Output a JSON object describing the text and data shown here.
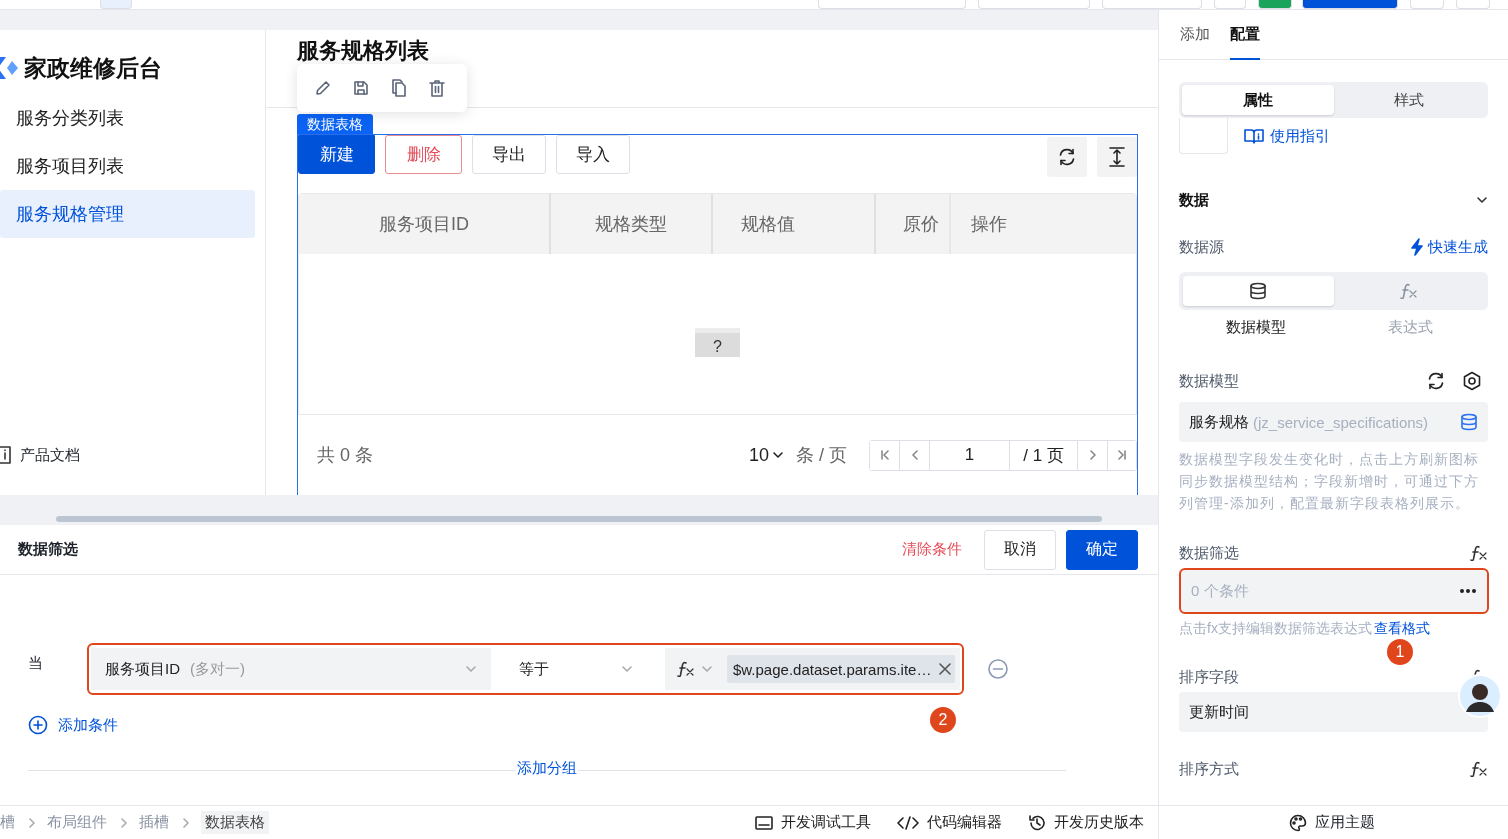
{
  "sidebar": {
    "app_title": "家政维修后台",
    "items": [
      {
        "label": "服务分类列表",
        "selected": false
      },
      {
        "label": "服务项目列表",
        "selected": false
      },
      {
        "label": "服务规格管理",
        "selected": true
      }
    ],
    "footer_link": "产品文档"
  },
  "canvas": {
    "page_title": "服务规格列表",
    "component_tag": "数据表格",
    "buttons": [
      {
        "label": "新建",
        "kind": "primary"
      },
      {
        "label": "删除",
        "kind": "danger"
      },
      {
        "label": "导出",
        "kind": "default"
      },
      {
        "label": "导入",
        "kind": "default"
      }
    ],
    "table": {
      "columns": [
        "服务项目ID",
        "规格类型",
        "规格值",
        "原价",
        "操作"
      ]
    },
    "help_tab": "?",
    "pagination": {
      "total_prefix": "共",
      "total": "0",
      "total_suffix": "条",
      "page_size": "10",
      "page_size_unit": "条 / 页",
      "page": "1",
      "page_total": "/ 1 页"
    }
  },
  "filter_dialog": {
    "title": "数据筛选",
    "clear": "清除条件",
    "cancel": "取消",
    "confirm": "确定",
    "when": "当",
    "condition": {
      "field": "服务项目ID",
      "field_note": "(多对一)",
      "operator": "等于",
      "value": "$w.page.dataset.params.ite…"
    },
    "badge": "2",
    "add_condition": "添加条件",
    "add_group": "添加分组"
  },
  "breadcrumb": [
    "槽",
    "布局组件",
    "插槽",
    "数据表格"
  ],
  "dev_tools": [
    "开发调试工具",
    "代码编辑器",
    "开发历史版本"
  ],
  "theme_button": "应用主题",
  "config_panel": {
    "tabs": [
      {
        "label": "添加",
        "selected": false
      },
      {
        "label": "配置",
        "selected": true
      }
    ],
    "mode_tabs": [
      {
        "label": "属性",
        "selected": true
      },
      {
        "label": "样式",
        "selected": false
      }
    ],
    "guide_link": "使用指引",
    "section": {
      "title": "数据",
      "expanded": true
    },
    "data_source": {
      "label": "数据源",
      "quick_link": "快速生成",
      "options": [
        {
          "kind": "model",
          "label": "数据模型",
          "selected": true
        },
        {
          "kind": "expression",
          "label": "表达式",
          "selected": false
        }
      ]
    },
    "data_model": {
      "label": "数据模型",
      "name": "服务规格",
      "table": "(jz_service_specifications)",
      "hint": "数据模型字段发生变化时，点击上方刷新图标同步数据模型结构；字段新增时，可通过下方列管理-添加列，配置最新字段表格列展示。"
    },
    "filter": {
      "label": "数据筛选",
      "value": "0 个条件",
      "hint": "点击fx支持编辑数据筛选表达式",
      "format_link": "查看格式",
      "badge": "1"
    },
    "sort_field": {
      "label": "排序字段",
      "value": "更新时间"
    },
    "sort_order": {
      "label": "排序方式"
    }
  }
}
